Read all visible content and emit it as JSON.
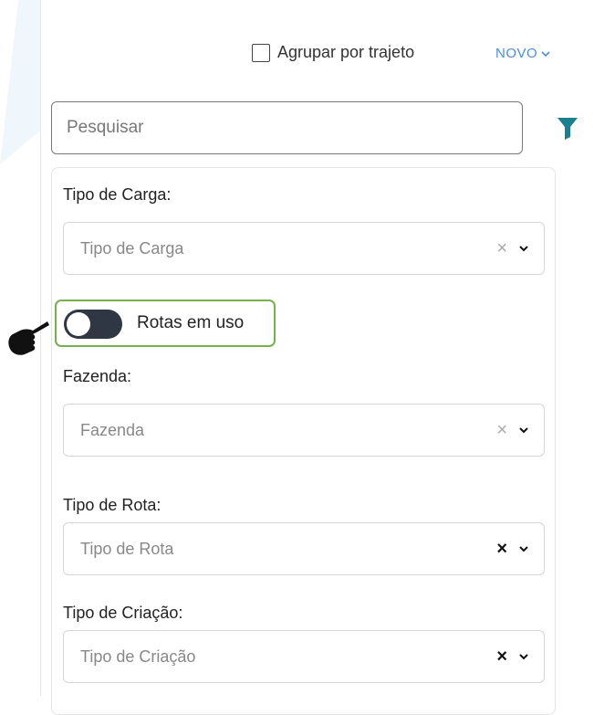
{
  "header": {
    "group_label": "Agrupar por trajeto",
    "group_checked": false,
    "new_label": "NOVO"
  },
  "search": {
    "placeholder": "Pesquisar"
  },
  "filters": {
    "load_type": {
      "label": "Tipo de Carga:",
      "placeholder": "Tipo de Carga"
    },
    "routes_toggle": {
      "label": "Rotas em uso",
      "on": false
    },
    "farm": {
      "label": "Fazenda:",
      "placeholder": "Fazenda"
    },
    "route_type": {
      "label": "Tipo de Rota:",
      "placeholder": "Tipo de Rota"
    },
    "creation_type": {
      "label": "Tipo de Criação:",
      "placeholder": "Tipo de Criação"
    }
  },
  "colors": {
    "accent_blue": "#4a8fd6",
    "filter_icon": "#1a7f8f",
    "highlight_green": "#76b150",
    "toggle_dark": "#2f3744"
  },
  "icons": {
    "filter": "funnel-icon",
    "pointer": "pointing-hand-icon",
    "clear": "x-icon",
    "caret": "chevron-down-icon"
  }
}
